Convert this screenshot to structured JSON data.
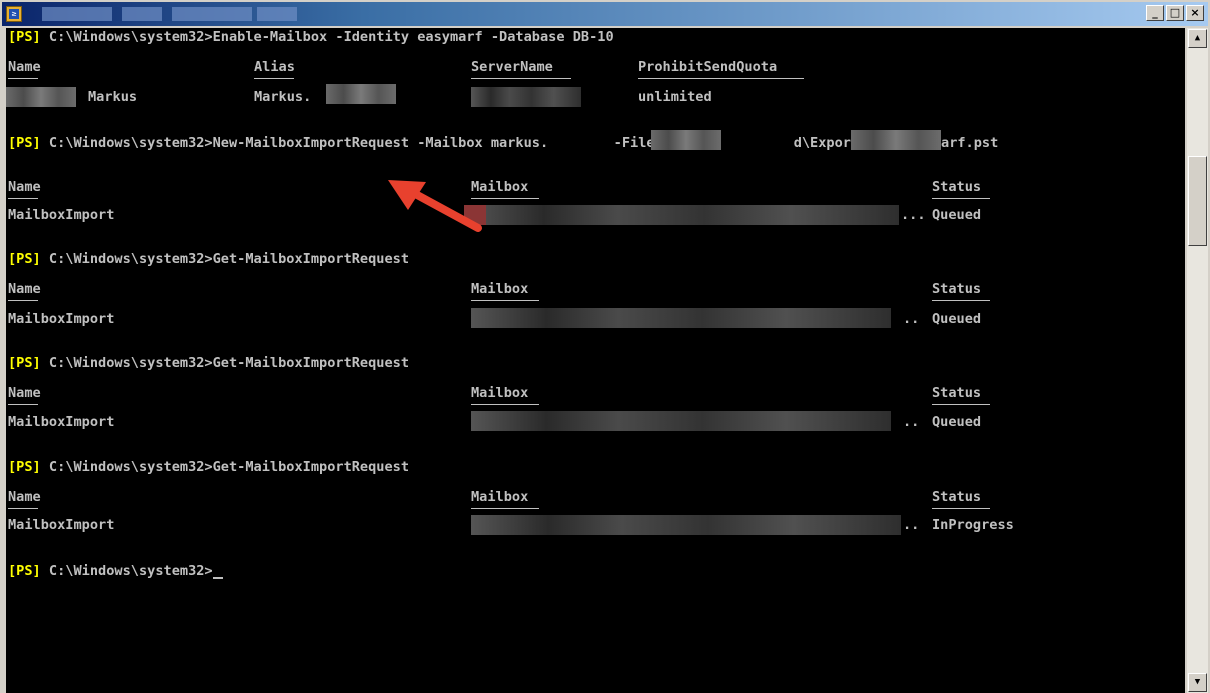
{
  "window": {
    "buttons": {
      "minimize": "_",
      "maximize": "□",
      "close": "×"
    }
  },
  "console": {
    "prompt_tag": "[PS]",
    "lines": [
      {
        "kind": "prompt",
        "text": " C:\\Windows\\system32>Enable-Mailbox -Identity easymarf -Database DB-10"
      },
      {
        "kind": "prompt",
        "text": " C:\\Windows\\system32>New-MailboxImportRequest -Mailbox markus.        -FilePath \\\\          d\\ExportPST$\\easymarf.pst"
      },
      {
        "kind": "prompt",
        "text": " C:\\Windows\\system32>Get-MailboxImportRequest"
      },
      {
        "kind": "prompt",
        "text": " C:\\Windows\\system32>Get-MailboxImportRequest"
      },
      {
        "kind": "prompt",
        "text": " C:\\Windows\\system32>Get-MailboxImportRequest"
      },
      {
        "kind": "prompt",
        "text": " C:\\Windows\\system32>"
      }
    ],
    "table1": {
      "headers": [
        "Name",
        "Alias",
        "ServerName",
        "ProhibitSendQuota"
      ],
      "row": [
        "Markus",
        "Markus.",
        "",
        "unlimited"
      ]
    },
    "table2": {
      "headers": [
        "Name",
        "Mailbox",
        "Status"
      ],
      "row": {
        "name": "MailboxImport",
        "ellipsis": "...",
        "status": "Queued"
      }
    },
    "table3": {
      "headers": [
        "Name",
        "Mailbox",
        "Status"
      ],
      "row": {
        "name": "MailboxImport",
        "ellipsis": "..",
        "status": "Queued"
      }
    },
    "table4": {
      "headers": [
        "Name",
        "Mailbox",
        "Status"
      ],
      "row": {
        "name": "MailboxImport",
        "ellipsis": "..",
        "status": "Queued"
      }
    },
    "table5": {
      "headers": [
        "Name",
        "Mailbox",
        "Status"
      ],
      "row": {
        "name": "MailboxImport",
        "ellipsis": "..",
        "status": "InProgress"
      }
    }
  },
  "scrollbar": {
    "up": "▲",
    "down": "▼"
  },
  "annotation": {
    "arrow_color": "#e8412e",
    "icon": "red-arrow-icon"
  }
}
